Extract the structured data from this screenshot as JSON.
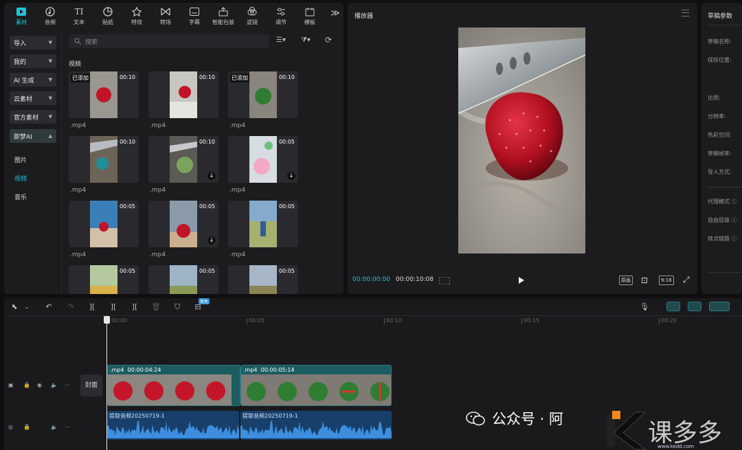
{
  "toolbar": {
    "items": [
      {
        "label": "素材",
        "icon": "media-icon",
        "active": true
      },
      {
        "label": "音频",
        "icon": "audio-icon"
      },
      {
        "label": "文本",
        "icon": "text-icon"
      },
      {
        "label": "贴纸",
        "icon": "sticker-icon"
      },
      {
        "label": "特效",
        "icon": "effects-icon"
      },
      {
        "label": "转场",
        "icon": "transition-icon"
      },
      {
        "label": "字幕",
        "icon": "subtitle-icon"
      },
      {
        "label": "智能包装",
        "icon": "smart-pack-icon"
      },
      {
        "label": "滤镜",
        "icon": "filter-icon"
      },
      {
        "label": "调节",
        "icon": "adjust-icon"
      },
      {
        "label": "模板",
        "icon": "template-icon"
      }
    ],
    "more": "≫"
  },
  "sidenav": {
    "buttons": [
      "导入",
      "我的",
      "AI 生成",
      "云素材",
      "官方素材",
      "即梦AI"
    ],
    "subitems": [
      "图片",
      "视频",
      "音乐"
    ]
  },
  "library": {
    "search_placeholder": "搜索",
    "section": "视频",
    "added_label": "已添加",
    "clips": [
      {
        "dur": "00:10",
        "name": ".mp4",
        "added": true,
        "download": false
      },
      {
        "dur": "00:10",
        "name": ".mp4",
        "added": false,
        "download": false
      },
      {
        "dur": "00:10",
        "name": ".mp4",
        "added": true,
        "download": false
      },
      {
        "dur": "00:10",
        "name": ".mp4",
        "added": false,
        "download": false
      },
      {
        "dur": "00:10",
        "name": ".mp4",
        "added": false,
        "download": true
      },
      {
        "dur": "00:05",
        "name": ".mp4",
        "added": false,
        "download": true
      },
      {
        "dur": "00:05",
        "name": ".mp4",
        "added": false,
        "download": false
      },
      {
        "dur": "00:05",
        "name": ".mp4",
        "added": false,
        "download": true
      },
      {
        "dur": "00:05",
        "name": ".mp4",
        "added": false,
        "download": false
      },
      {
        "dur": "00:05",
        "name": "",
        "added": false,
        "download": false
      },
      {
        "dur": "00:05",
        "name": "",
        "added": false,
        "download": false
      },
      {
        "dur": "00:05",
        "name": "",
        "added": false,
        "download": false
      }
    ]
  },
  "player": {
    "title": "播放器",
    "current_time": "00:00:00:00",
    "total_time": "00:00:10:08",
    "btn_fit": "原画",
    "btn_ratio": "9:16"
  },
  "params": {
    "title": "草稿参数",
    "labels": [
      "草稿名称:",
      "保存位置:",
      "比例:",
      "分辨率:",
      "色彩空间:",
      "草稿帧率:",
      "导入方式:",
      "代理模式 ⓘ",
      "自由层级 ⓘ",
      "续点链路 ⓘ"
    ]
  },
  "timeline": {
    "free_badge": "限免",
    "ticks": [
      "00:00",
      "00:05",
      "00:10",
      "00:15",
      "00:20"
    ],
    "cover_label": "封面",
    "video_clips": [
      {
        "name": ".mp4",
        "duration": "00:00:04:24"
      },
      {
        "name": ".mp4",
        "duration": "00:00:05:14"
      }
    ],
    "audio_clips": [
      {
        "name": "提取音频20250719-1"
      },
      {
        "name": "提取音频20250719-1"
      }
    ]
  },
  "watermark": {
    "text": "公众号 · 阿",
    "site": "www.kedd.com"
  },
  "colors": {
    "accent": "#22c3d6",
    "video_clip": "#1b5c60",
    "audio_clip": "#173f6a"
  }
}
